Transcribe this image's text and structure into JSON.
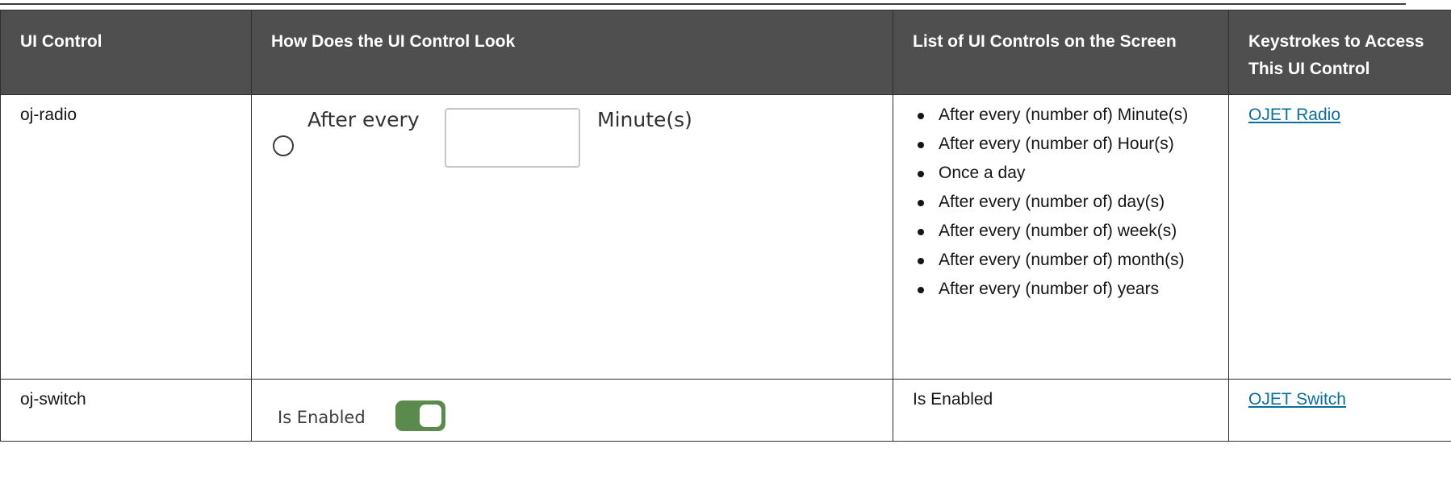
{
  "table": {
    "headers": [
      "UI Control",
      "How Does the UI Control Look",
      "List of UI Controls on the Screen",
      "Keystrokes to Access This UI Control"
    ],
    "rows": [
      {
        "control": "oj-radio",
        "look": {
          "type": "radio",
          "label": "After every",
          "input_value": "",
          "suffix": "Minute(s)"
        },
        "list": [
          "After every (number of) Minute(s)",
          "After every (number of) Hour(s)",
          "Once a day",
          "After every (number of) day(s)",
          "After every (number of) week(s)",
          "After every (number of) month(s)",
          "After every (number of) years"
        ],
        "link": "OJET Radio"
      },
      {
        "control": "oj-switch",
        "look": {
          "type": "switch",
          "label": "Is Enabled",
          "state": "on",
          "track_color": "#5b8a4d"
        },
        "list_text": "Is Enabled",
        "link": "OJET Switch"
      }
    ]
  },
  "colors": {
    "header_bg": "#4f4f4f",
    "link": "#0b6f9e"
  }
}
